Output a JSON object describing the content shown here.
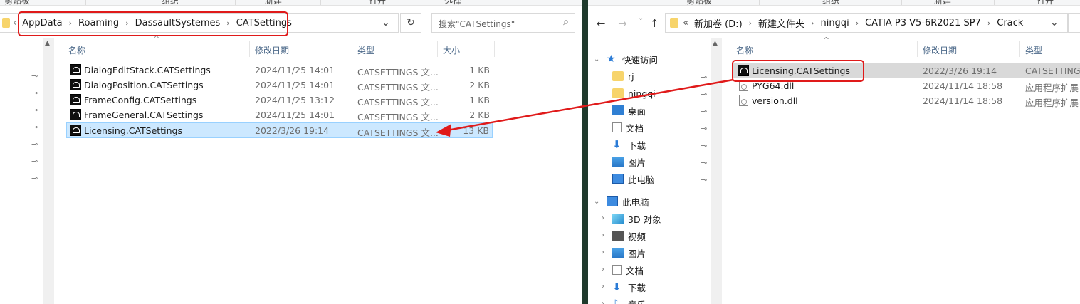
{
  "left_window": {
    "ribbon": [
      "剪贴板",
      "组织",
      "新建",
      "打开",
      "选择"
    ],
    "address": {
      "breadcrumbs": [
        "AppData",
        "Roaming",
        "DassaultSystemes",
        "CATSettings"
      ],
      "overflow_glyph": "‹",
      "dropdown_glyph": "⌄",
      "refresh_glyph": "↻"
    },
    "search": {
      "placeholder": "搜索\"CATSettings\"",
      "icon_glyph": "⌕"
    },
    "columns": {
      "name": "名称",
      "modified": "修改日期",
      "type": "类型",
      "size": "大小"
    },
    "files": [
      {
        "name": "DialogEditStack.CATSettings",
        "modified": "2024/11/25 14:01",
        "type": "CATSETTINGS 文...",
        "size": "1 KB"
      },
      {
        "name": "DialogPosition.CATSettings",
        "modified": "2024/11/25 14:01",
        "type": "CATSETTINGS 文...",
        "size": "2 KB"
      },
      {
        "name": "FrameConfig.CATSettings",
        "modified": "2024/11/25 13:12",
        "type": "CATSETTINGS 文...",
        "size": "1 KB"
      },
      {
        "name": "FrameGeneral.CATSettings",
        "modified": "2024/11/25 14:01",
        "type": "CATSETTINGS 文...",
        "size": "2 KB"
      },
      {
        "name": "Licensing.CATSettings",
        "modified": "2022/3/26 19:14",
        "type": "CATSETTINGS 文...",
        "size": "13 KB"
      }
    ],
    "selected_index": 4,
    "pin_glyph": "📌"
  },
  "right_window": {
    "ribbon": [
      "剪贴板",
      "组织",
      "新建",
      "打开"
    ],
    "nav_buttons": {
      "back": "←",
      "forward": "→",
      "up": "↑"
    },
    "address": {
      "overflow_glyph": "«",
      "breadcrumbs": [
        "新加卷 (D:)",
        "新建文件夹",
        "ningqi",
        "CATIA P3 V5-6R2021 SP7",
        "Crack"
      ],
      "dropdown_glyph": "⌄"
    },
    "columns": {
      "name": "名称",
      "modified": "修改日期",
      "type": "类型"
    },
    "files": [
      {
        "name": "Licensing.CATSettings",
        "modified": "2022/3/26 19:14",
        "type": "CATSETTINGS",
        "icon": "catsettings-icon"
      },
      {
        "name": "PYG64.dll",
        "modified": "2024/11/14 18:58",
        "type": "应用程序扩展",
        "icon": "dll-icon"
      },
      {
        "name": "version.dll",
        "modified": "2024/11/14 18:58",
        "type": "应用程序扩展",
        "icon": "dll-icon"
      }
    ],
    "nav_tree": {
      "quick_access": "快速访问",
      "quick_items": [
        "rj",
        "ningqi",
        "桌面",
        "文档",
        "下载",
        "图片",
        "此电脑"
      ],
      "this_pc": "此电脑",
      "pc_items": [
        "3D 对象",
        "视频",
        "图片",
        "文档",
        "下载",
        "音乐"
      ]
    }
  },
  "colors": {
    "annotation_red": "#e01a1a",
    "selection_blue": "#cce8ff",
    "divider": "#1f3a2c"
  }
}
